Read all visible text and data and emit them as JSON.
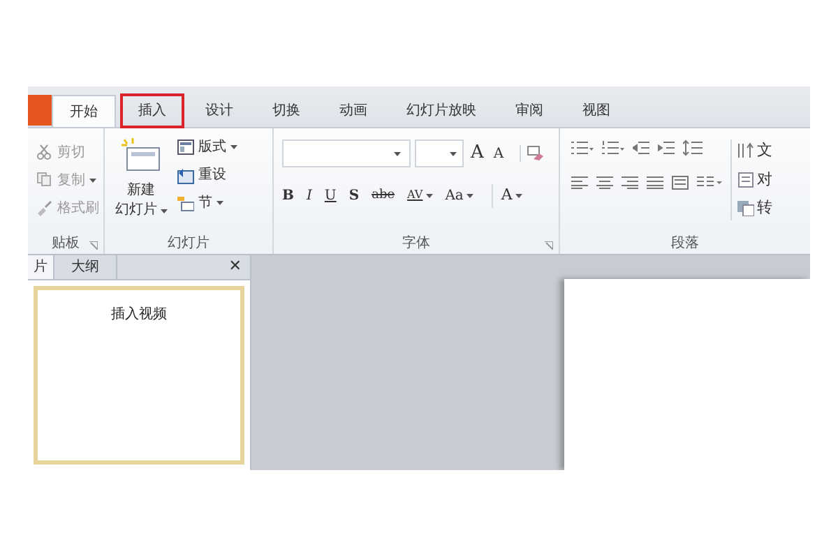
{
  "tabs": [
    {
      "label": "开始",
      "selected": true,
      "highlighted": false
    },
    {
      "label": "插入",
      "selected": false,
      "highlighted": true
    },
    {
      "label": "设计",
      "selected": false,
      "highlighted": false
    },
    {
      "label": "切换",
      "selected": false,
      "highlighted": false
    },
    {
      "label": "动画",
      "selected": false,
      "highlighted": false
    },
    {
      "label": "幻灯片放映",
      "selected": false,
      "highlighted": false
    },
    {
      "label": "审阅",
      "selected": false,
      "highlighted": false
    },
    {
      "label": "视图",
      "selected": false,
      "highlighted": false
    }
  ],
  "clipboard": {
    "label": "贴板",
    "items": [
      {
        "label": "剪切",
        "disabled": true,
        "dropdown": false
      },
      {
        "label": "复制",
        "disabled": true,
        "dropdown": true
      },
      {
        "label": "格式刷",
        "disabled": true,
        "dropdown": false
      }
    ]
  },
  "slides": {
    "label": "幻灯片",
    "new_slide": [
      "新建",
      "幻灯片"
    ],
    "items": [
      {
        "label": "版式",
        "dropdown": true
      },
      {
        "label": "重设",
        "dropdown": false
      },
      {
        "label": "节",
        "dropdown": true
      }
    ]
  },
  "font": {
    "label": "字体",
    "size_buttons": [
      "A",
      "A"
    ],
    "format_buttons": [
      {
        "label": "B",
        "dropdown": false
      },
      {
        "label": "I",
        "dropdown": false
      },
      {
        "label": "U",
        "dropdown": false
      },
      {
        "label": "S",
        "dropdown": false
      },
      {
        "label": "abe",
        "dropdown": false
      },
      {
        "label": "AV",
        "dropdown": true
      },
      {
        "label": "Aa",
        "dropdown": true
      },
      {
        "label": "A",
        "dropdown": true
      }
    ]
  },
  "paragraph": {
    "label": "段落",
    "side_items": [
      "文",
      "对",
      "转"
    ]
  },
  "panel": {
    "tabs": [
      {
        "label": "片",
        "selected": true
      },
      {
        "label": "大纲",
        "selected": false
      }
    ],
    "close": "✕",
    "thumbnail_title": "插入视频"
  }
}
